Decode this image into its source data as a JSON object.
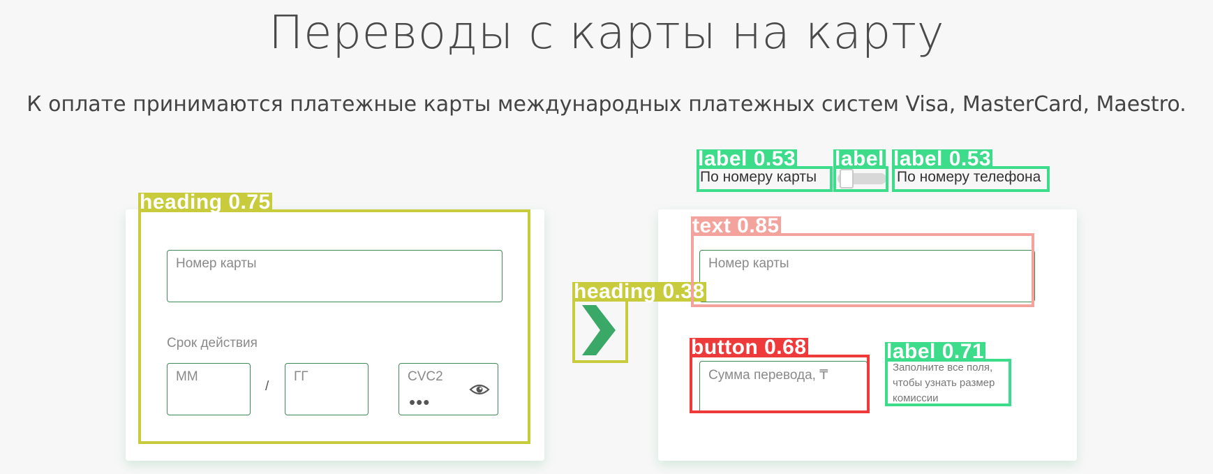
{
  "page": {
    "title": "Переводы с карты на карту",
    "subtitle": "К оплате принимаются платежные карты международных платежных систем Visa, MasterCard, Maestro."
  },
  "sender_card": {
    "card_number_placeholder": "Номер карты",
    "expiry_label": "Срок действия",
    "month_placeholder": "ММ",
    "separator": "/",
    "year_placeholder": "ГГ",
    "cvc_label": "CVC2",
    "cvc_mask": "•••",
    "show_cvc_icon": "eye-icon"
  },
  "transfer_arrow_icon": "chevron-right-icon",
  "recipient": {
    "mode_card_label": "По номеру карты",
    "mode_phone_label": "По номеру телефона",
    "card_number_placeholder": "Номер карты",
    "amount_placeholder": "Сумма перевода, ₸",
    "commission_note": "Заполните все поля, чтобы узнать размер комиссии"
  },
  "detections": [
    {
      "label": "heading 0.75"
    },
    {
      "label": "heading 0.38"
    },
    {
      "label": "label 0.53"
    },
    {
      "label": "label"
    },
    {
      "label": "label 0.53"
    },
    {
      "label": "text 0.85"
    },
    {
      "label": "button 0.68"
    },
    {
      "label": "label 0.71"
    }
  ],
  "colors": {
    "accent_green": "#3aa867",
    "field_border": "#3d8a55",
    "detection_heading": "#c8cc3c",
    "detection_label": "#3ddc8a",
    "detection_text": "#f4a29c",
    "detection_button": "#ee3a3a"
  }
}
